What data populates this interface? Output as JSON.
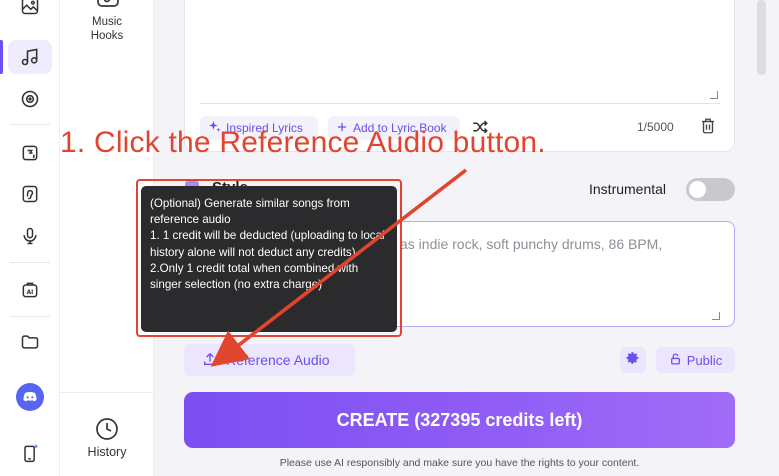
{
  "sidebar": {
    "items": [
      {
        "icon": "image-icon"
      },
      {
        "icon": "music-note-icon",
        "active": true
      },
      {
        "icon": "disc-icon"
      },
      {
        "icon": "speech-tile-icon"
      },
      {
        "icon": "ear-icon"
      },
      {
        "icon": "microphone-icon"
      },
      {
        "icon": "ai-tile-icon"
      },
      {
        "icon": "folder-icon"
      },
      {
        "icon": "discord-icon"
      },
      {
        "icon": "phone-sparkle-icon"
      }
    ],
    "accent_color": "#6f4cf6"
  },
  "subnav": {
    "music_hooks": "Music\nHooks",
    "history": "History"
  },
  "lyrics": {
    "inspired_label": "Inspired Lyrics",
    "add_book_label": "Add to Lyric Book",
    "counter": "1/5000"
  },
  "style": {
    "title": "Style",
    "instrumental_label": "Instrumental",
    "instrumental_on": false,
    "placeholder_visible": "as indie rock, soft punchy drums, 86 BPM,"
  },
  "tooltip": {
    "line1": "(Optional) Generate similar songs from reference audio",
    "line2": "1. 1 credit will be deducted (uploading to local history alone will not deduct any credits).",
    "line3": "2.Only 1 credit total when combined with singer selection (no extra charge)"
  },
  "actions": {
    "reference_audio_label": "Reference Audio",
    "public_label": "Public",
    "create_label": "CREATE (327395 credits left)",
    "disclaimer": "Please use AI responsibly and make sure you have the rights to your content."
  },
  "annotation": {
    "instruction": "1. Click the Reference Audio button.",
    "color": "#e2452f"
  },
  "brand": {
    "primary": "#6b4ff0",
    "discord": "#5865f2"
  }
}
